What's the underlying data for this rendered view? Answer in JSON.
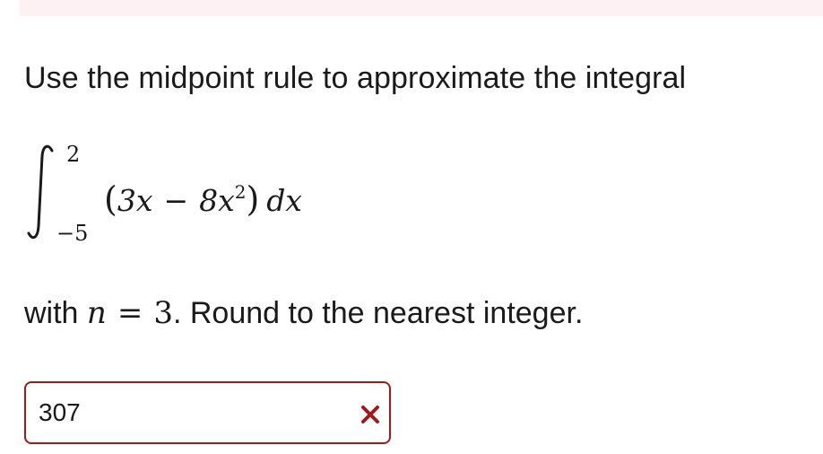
{
  "question": {
    "intro": "Use the midpoint rule to approximate the integral",
    "integral": {
      "upper_limit": "2",
      "lower_limit": "−5",
      "open_paren": "(",
      "term1": "3x",
      "operator": "−",
      "term2_coef": "8x",
      "term2_power": "2",
      "close_paren": ")",
      "differential": "dx"
    },
    "with_prefix": "with ",
    "n_symbol": "n",
    "equals": "=",
    "n_value": "3",
    "instruction": ". Round to the nearest integer."
  },
  "answer": {
    "value": "307",
    "status": "incorrect",
    "status_icon": "x-mark-icon",
    "status_color": "#a11a1a"
  },
  "colors": {
    "top_band": "#fdf1f1",
    "error_border": "#a11a1a"
  }
}
